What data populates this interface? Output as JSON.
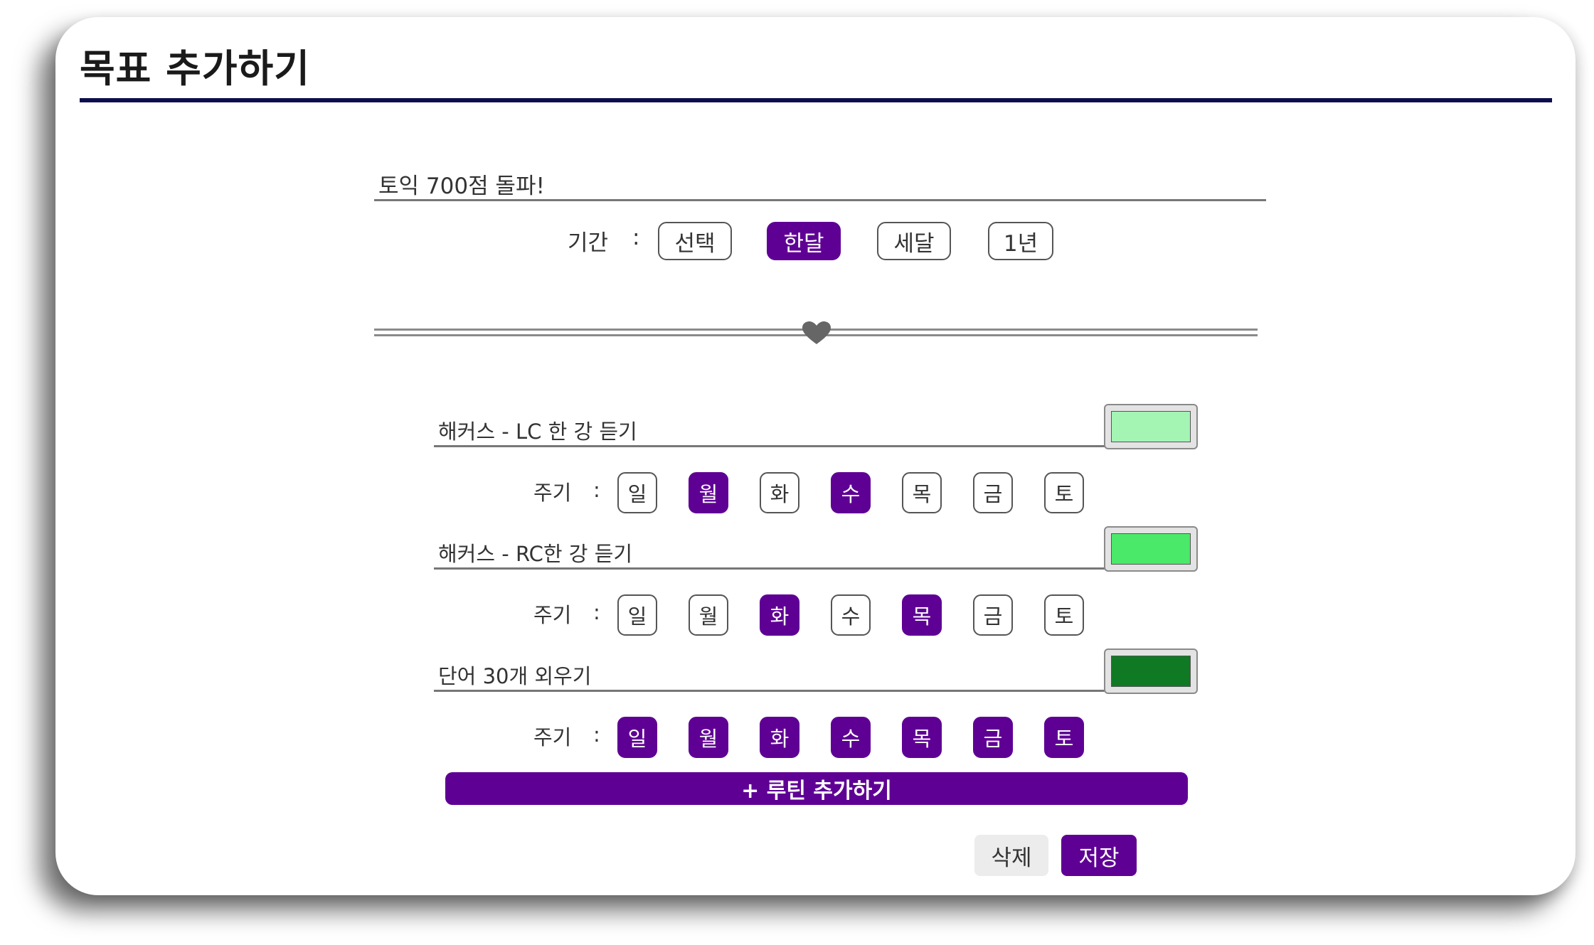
{
  "dialog": {
    "title": "목표 추가하기"
  },
  "goal": {
    "value": "토익 700점 돌파!",
    "period_label": "기간",
    "separator": ":",
    "period_options": [
      "선택",
      "한달",
      "세달",
      "1년"
    ],
    "selected_period": "한달"
  },
  "routines": [
    {
      "name": "해커스 - LC 한 강 듣기",
      "color": "#a4f4b4",
      "cycle_label": "주기",
      "separator": ":",
      "days": [
        {
          "label": "일",
          "on": false
        },
        {
          "label": "월",
          "on": true
        },
        {
          "label": "화",
          "on": false
        },
        {
          "label": "수",
          "on": true
        },
        {
          "label": "목",
          "on": false
        },
        {
          "label": "금",
          "on": false
        },
        {
          "label": "토",
          "on": false
        }
      ]
    },
    {
      "name": "해커스 - RC한 강 듣기",
      "color": "#4ae96a",
      "cycle_label": "주기",
      "separator": ":",
      "days": [
        {
          "label": "일",
          "on": false
        },
        {
          "label": "월",
          "on": false
        },
        {
          "label": "화",
          "on": true
        },
        {
          "label": "수",
          "on": false
        },
        {
          "label": "목",
          "on": true
        },
        {
          "label": "금",
          "on": false
        },
        {
          "label": "토",
          "on": false
        }
      ]
    },
    {
      "name": "단어 30개 외우기",
      "color": "#0f7a23",
      "cycle_label": "주기",
      "separator": ":",
      "days": [
        {
          "label": "일",
          "on": true
        },
        {
          "label": "월",
          "on": true
        },
        {
          "label": "화",
          "on": true
        },
        {
          "label": "수",
          "on": true
        },
        {
          "label": "목",
          "on": true
        },
        {
          "label": "금",
          "on": true
        },
        {
          "label": "토",
          "on": true
        }
      ]
    }
  ],
  "actions": {
    "add_routine": "+ 루틴 추가하기",
    "delete": "삭제",
    "save": "저장"
  },
  "colors": {
    "accent": "#5f0094",
    "title_rule": "#0e0e4d"
  },
  "icons": {
    "divider": "heart-icon"
  }
}
